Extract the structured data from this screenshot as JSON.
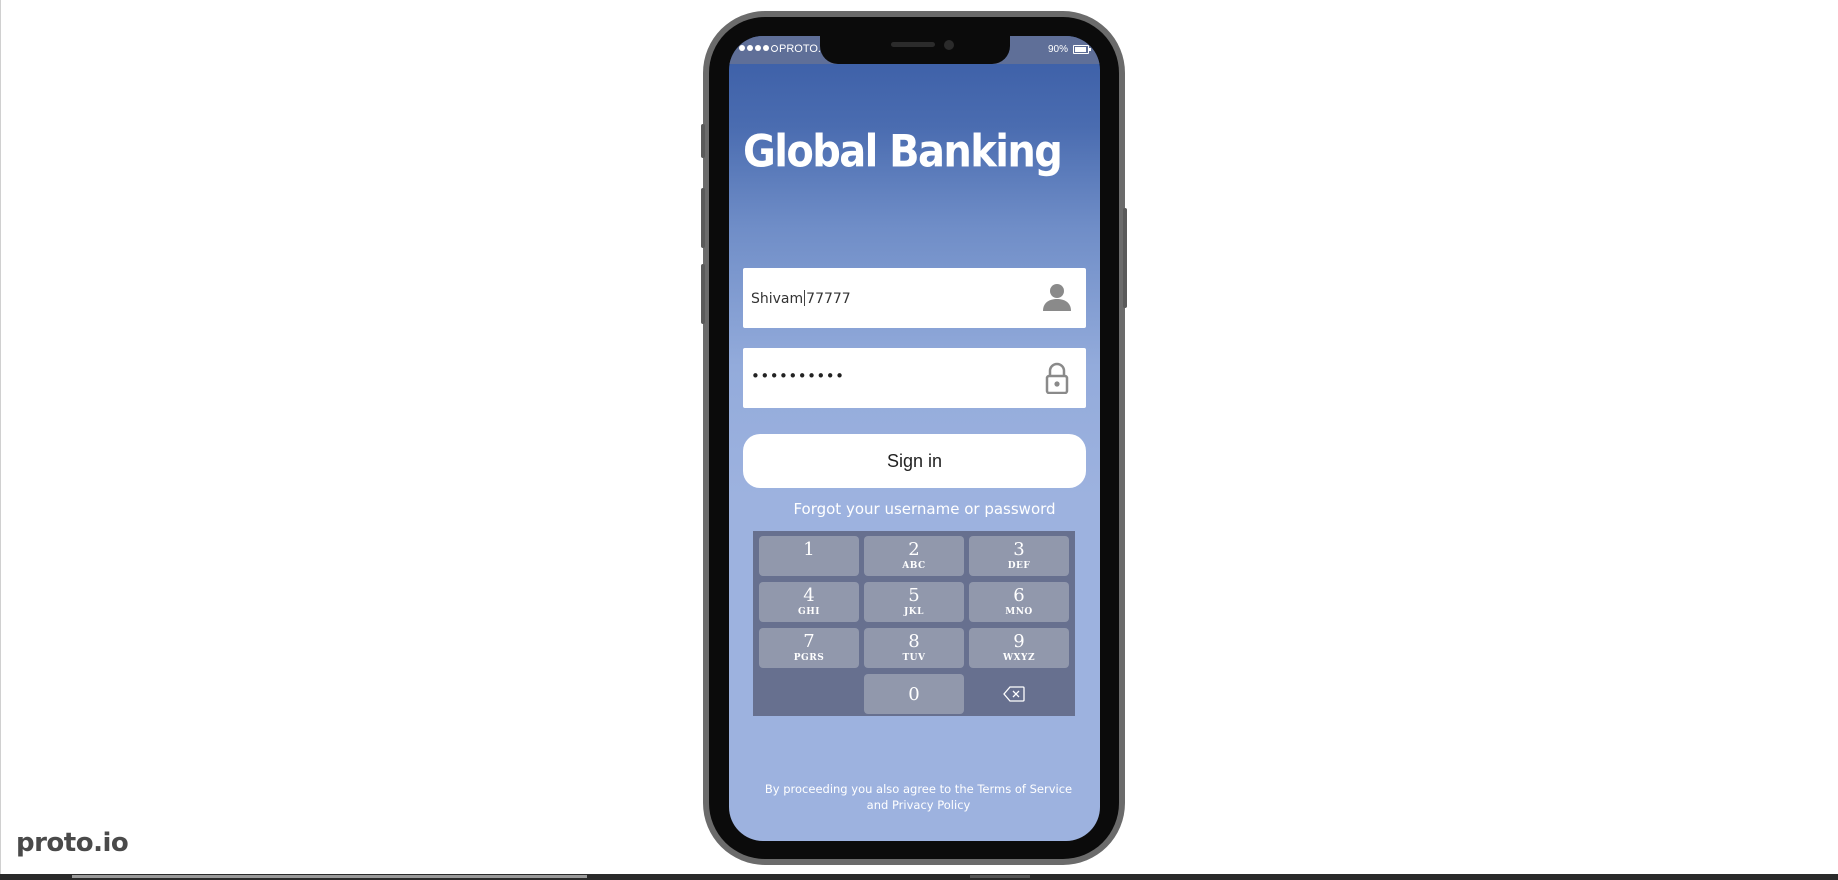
{
  "status_bar": {
    "carrier": "PROTO.IO",
    "battery": "90%"
  },
  "app": {
    "title": "Global Banking"
  },
  "login": {
    "username_before_cursor": "Shivam",
    "username_after_cursor": "77777",
    "password_mask": "••••••••••",
    "sign_in_label": "Sign in",
    "forgot_label": "Forgot your username or password"
  },
  "keypad": {
    "keys": [
      {
        "num": "1",
        "letters": ""
      },
      {
        "num": "2",
        "letters": "ABC"
      },
      {
        "num": "3",
        "letters": "DEF"
      },
      {
        "num": "4",
        "letters": "GHI"
      },
      {
        "num": "5",
        "letters": "JKL"
      },
      {
        "num": "6",
        "letters": "MNO"
      },
      {
        "num": "7",
        "letters": "PGRS"
      },
      {
        "num": "8",
        "letters": "TUV"
      },
      {
        "num": "9",
        "letters": "WXYZ"
      },
      {
        "num": "0",
        "letters": ""
      }
    ]
  },
  "footer": {
    "terms_line1": "By proceeding you also agree to the Terms of Service",
    "terms_line2": "and Privacy Policy"
  },
  "brand": {
    "logo_text": "proto.io"
  },
  "icons": {
    "user": "user-icon",
    "lock": "lock-icon",
    "backspace": "backspace-icon"
  },
  "colors": {
    "status_bar": "#5f6f98",
    "gradient_top": "#3a5da6",
    "gradient_bottom": "#9db2df",
    "keypad_bg": "#67708f",
    "key_bg": "#9198ac"
  }
}
